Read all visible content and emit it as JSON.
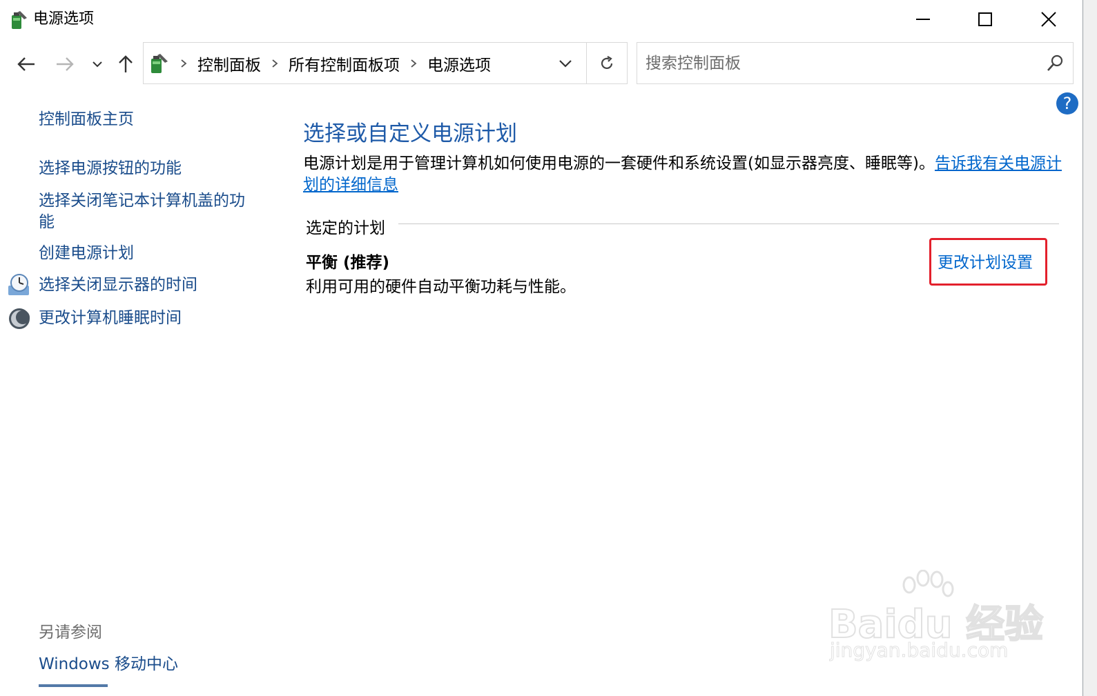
{
  "window": {
    "title": "电源选项"
  },
  "navigation": {
    "breadcrumbs": [
      "控制面板",
      "所有控制面板项",
      "电源选项"
    ]
  },
  "search": {
    "placeholder": "搜索控制面板"
  },
  "help": {
    "label": "?"
  },
  "sidebar": {
    "home": "控制面板主页",
    "links": [
      "选择电源按钮的功能",
      "选择关闭笔记本计算机盖的功能",
      "创建电源计划",
      "选择关闭显示器的时间",
      "更改计算机睡眠时间"
    ],
    "see_also_label": "另请参阅",
    "see_also_links": [
      "Windows 移动中心"
    ]
  },
  "main": {
    "title": "选择或自定义电源计划",
    "description": "电源计划是用于管理计算机如何使用电源的一套硬件和系统设置(如显示器亮度、睡眠等)。",
    "description_link": "告诉我有关电源计划的详细信息",
    "section_label": "选定的计划",
    "plan": {
      "name": "平衡 (推荐)",
      "description": "利用可用的硬件自动平衡功耗与性能。",
      "change_link": "更改计划设置"
    }
  },
  "watermark": {
    "brand": "Baidu 经验",
    "url": "jingyan.baidu.com"
  },
  "colors": {
    "link": "#1a4c8b",
    "accent_link": "#0066cc",
    "title": "#1e5aa8",
    "highlight": "#e3202c"
  }
}
